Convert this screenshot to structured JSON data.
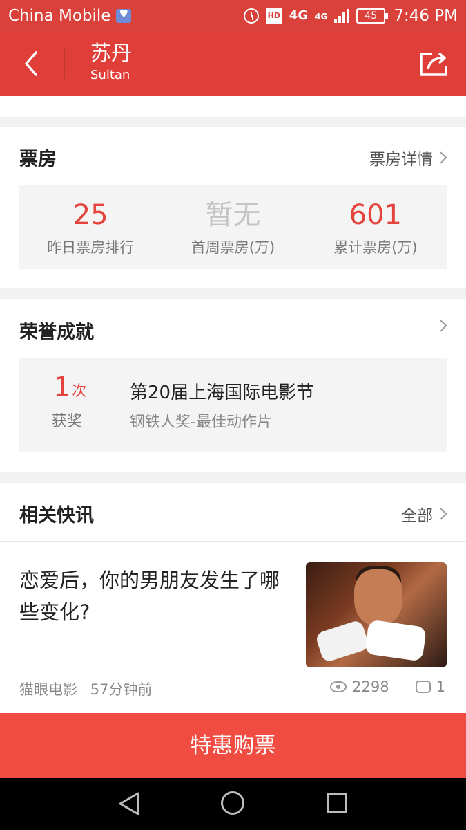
{
  "status_bar": {
    "carrier": "China Mobile",
    "hd": "HD",
    "network1": "4G",
    "network2": "4G",
    "battery": "45",
    "time": "7:46 PM"
  },
  "nav": {
    "title": "苏丹",
    "subtitle": "Sultan"
  },
  "box_office": {
    "title": "票房",
    "details_link": "票房详情",
    "stats": [
      {
        "value": "25",
        "label": "昨日票房排行"
      },
      {
        "value": "暂无",
        "label": "首周票房(万)"
      },
      {
        "value": "601",
        "label": "累计票房(万)"
      }
    ]
  },
  "honors": {
    "title": "荣誉成就",
    "count": "1",
    "count_unit": "次",
    "count_label": "获奖",
    "festival": "第20届上海国际电影节",
    "award": "钢铁人奖-最佳动作片"
  },
  "news": {
    "title": "相关快讯",
    "all_link": "全部",
    "item": {
      "headline": "恋爱后，你的男朋友发生了哪些变化?",
      "source": "猫眼电影",
      "time": "57分钟前",
      "views": "2298",
      "comments": "1"
    }
  },
  "buy_button": "特惠购票",
  "colors": {
    "brand_red": "#df3f38",
    "accent_red": "#e3443c",
    "buy_red": "#f04c42"
  }
}
